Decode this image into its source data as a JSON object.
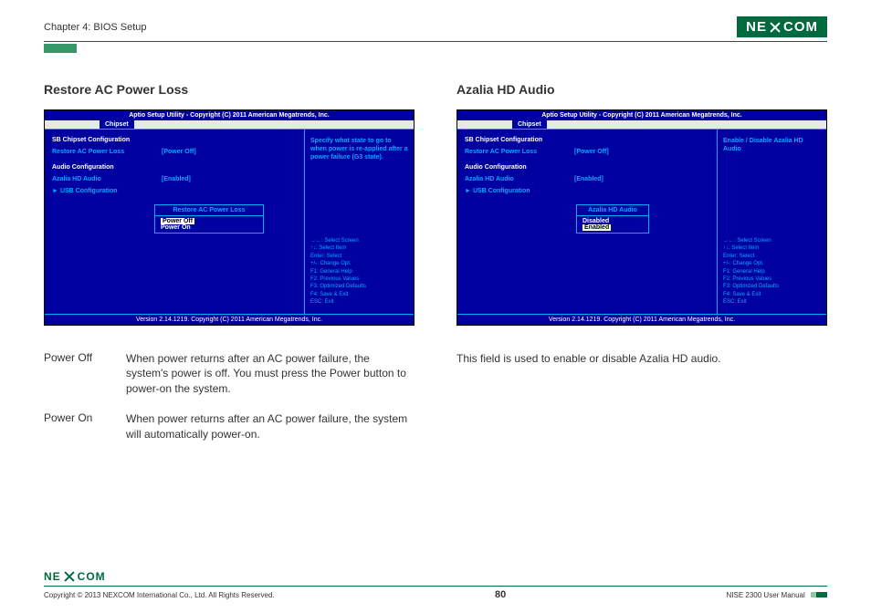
{
  "header": {
    "chapter": "Chapter 4: BIOS Setup",
    "brand_pre": "NE",
    "brand_post": "COM"
  },
  "left": {
    "title": "Restore AC Power Loss",
    "bios": {
      "header": "Aptio Setup Utility - Copyright (C) 2011 American Megatrends, Inc.",
      "tab": "Chipset",
      "cfg_heading": "SB Chipset Configuration",
      "row1_label": "Restore AC Power Loss",
      "row1_value": "[Power Off]",
      "audio_heading": "Audio Configuration",
      "row2_label": "Azalia HD Audio",
      "row2_value": "[Enabled]",
      "usb_link": "USB Configuration",
      "help": "Specify what state to go to when power is re-applied after a power failure (G3 state).",
      "keys": "→←: Select Screen\n↑↓: Select Item\nEnter: Select\n+/-: Change Opt.\nF1: General Help\nF2: Previous Values\nF3: Optimized Defaults\nF4: Save & Exit\nESC: Exit",
      "popup_title": "Restore AC Power Loss",
      "popup_opt1": "Power Off",
      "popup_opt2": "Power On",
      "footer": "Version 2.14.1219. Copyright (C) 2011 American Megatrends, Inc."
    },
    "desc": [
      {
        "term": "Power Off",
        "text": "When power returns after an AC power failure, the system's power is off. You must press the Power button to power-on the system."
      },
      {
        "term": "Power On",
        "text": "When power returns after an AC power failure, the system will automatically power-on."
      }
    ]
  },
  "right": {
    "title": "Azalia HD Audio",
    "bios": {
      "header": "Aptio Setup Utility - Copyright (C) 2011 American Megatrends, Inc.",
      "tab": "Chipset",
      "cfg_heading": "SB Chipset Configuration",
      "row1_label": "Restore AC Power Loss",
      "row1_value": "[Power Off]",
      "audio_heading": "Audio Configuration",
      "row2_label": "Azalia HD Audio",
      "row2_value": "[Enabled]",
      "usb_link": "USB Configuration",
      "help": "Enable / Disable Azalia HD Audio",
      "keys": "→←: Select Screen\n↑↓: Select Item\nEnter: Select\n+/-: Change Opt.\nF1: General Help\nF2: Previous Values\nF3: Optimized Defaults\nF4: Save & Exit\nESC: Exit",
      "popup_title": "Azalia HD Audio",
      "popup_opt1": "Disabled",
      "popup_opt2": "Enabled",
      "footer": "Version 2.14.1219. Copyright (C) 2011 American Megatrends, Inc."
    },
    "desc_single": "This field is used to enable or disable Azalia HD audio."
  },
  "footer": {
    "copyright": "Copyright © 2013 NEXCOM International Co., Ltd. All Rights Reserved.",
    "page": "80",
    "manual": "NISE 2300 User Manual"
  }
}
